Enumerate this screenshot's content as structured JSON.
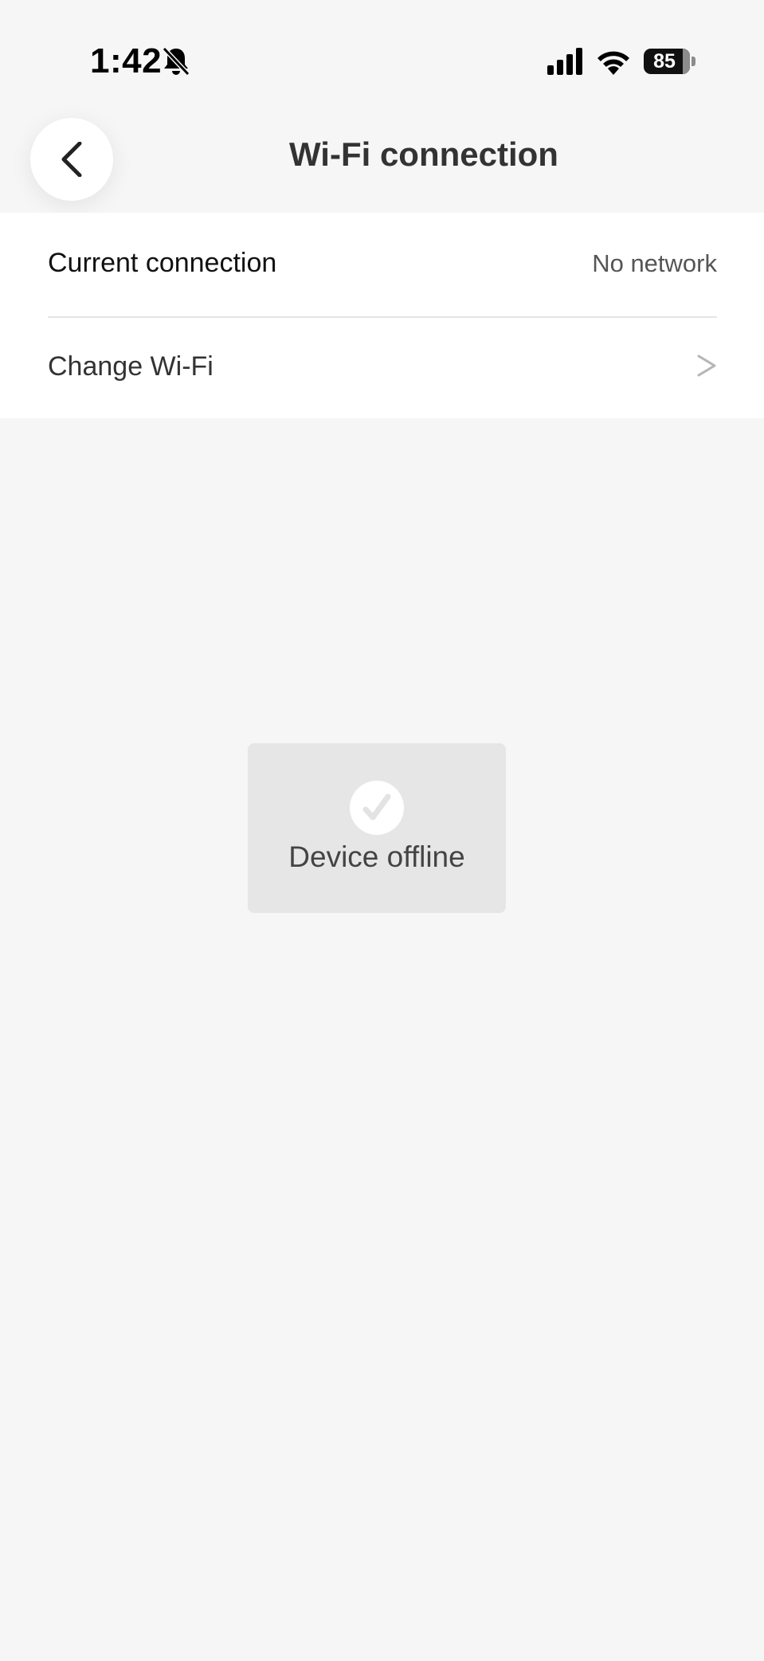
{
  "status_bar": {
    "time": "1:42",
    "battery_level": "85",
    "battery_fraction": 0.85
  },
  "nav": {
    "title": "Wi-Fi connection",
    "back_icon": "chevron-left-icon"
  },
  "settings": {
    "current_connection_label": "Current connection",
    "current_connection_value": "No network",
    "change_wifi_label": "Change Wi-Fi",
    "change_wifi_icon": "chevron-right-icon"
  },
  "toast": {
    "message": "Device offline",
    "icon": "checkmark-icon"
  },
  "colors": {
    "background": "#f6f6f6",
    "card": "#ffffff",
    "toast_background": "#e6e6e6",
    "chevron": "#b5b5b5"
  }
}
